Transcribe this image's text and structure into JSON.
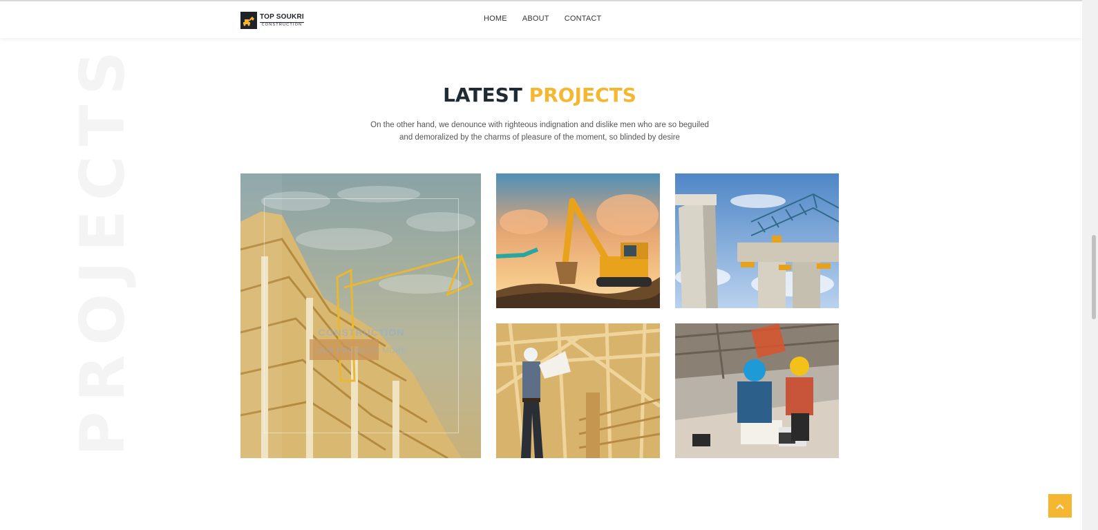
{
  "brand": {
    "name": "TOP SOUKRI",
    "tagline": "CONSTRUCTION"
  },
  "nav": {
    "items": [
      "HOME",
      "ABOUT",
      "CONTACT"
    ]
  },
  "section": {
    "watermark": "PROJECTS",
    "title_main": "LATEST",
    "title_accent": "PROJECTS",
    "description": "On the other hand, we denounce with righteous indignation and dislike men who are so beguiled and demoralized by the charms of pleasure of the moment, so blinded by desire"
  },
  "projects": {
    "featured": {
      "title": "CONSTRUCTION",
      "subtitle": "OUR PROJECTS MORE"
    }
  },
  "colors": {
    "accent": "#f5b731",
    "dark": "#1f2a33"
  },
  "icons": {
    "scroll_top": "chevron-up-icon",
    "logo": "excavator-icon"
  }
}
